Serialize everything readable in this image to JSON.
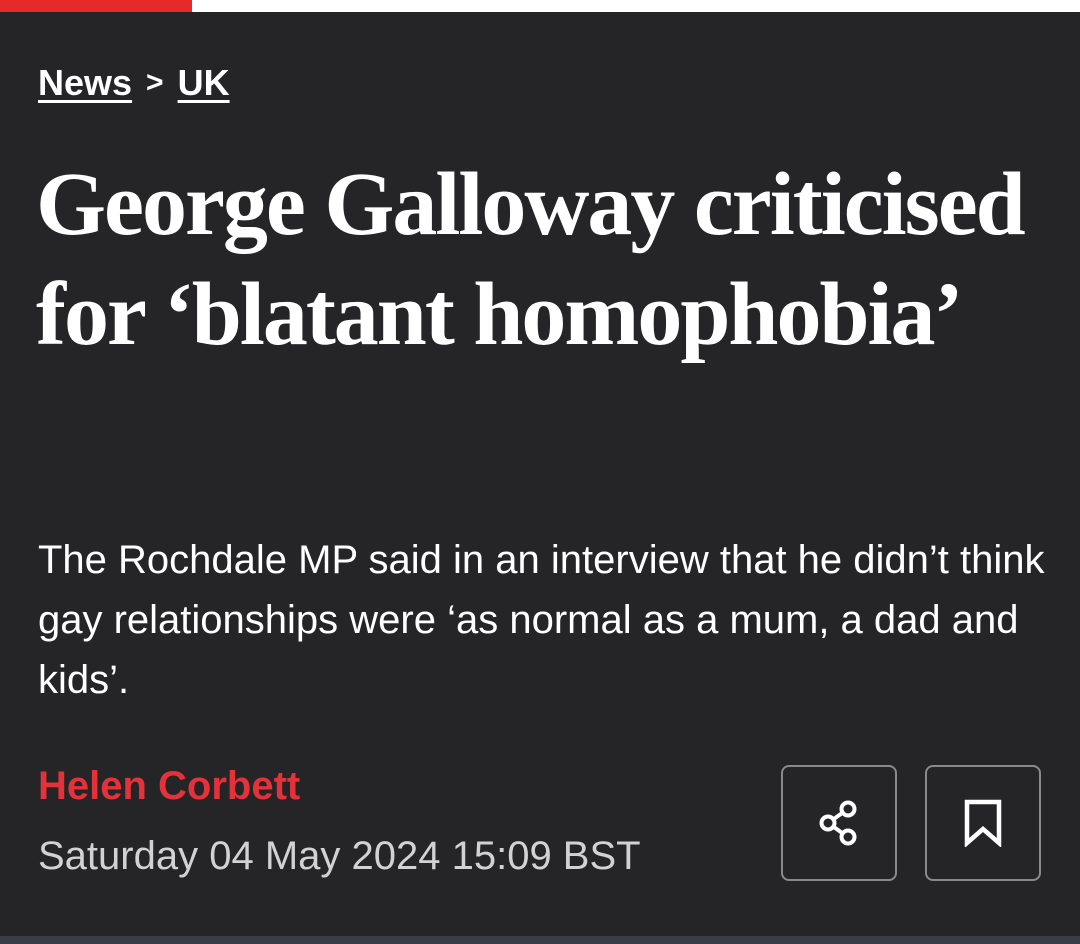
{
  "breadcrumb": {
    "section": "News",
    "separator": ">",
    "subsection": "UK"
  },
  "article": {
    "headline": "George Galloway criticised for ‘blatant homophobia’",
    "standfirst": "The Rochdale MP said in an interview that he didn’t think gay relationships were ‘as normal as a mum, a dad and kids’.",
    "author": "Helen Corbett",
    "date": "Saturday 04 May 2024 15:09 BST"
  },
  "actions": {
    "share_icon": "share-icon",
    "bookmark_icon": "bookmark-icon"
  },
  "colors": {
    "background": "#252527",
    "accent": "#e42a2a",
    "author": "#e4323a",
    "text": "#ffffff",
    "date": "#d2d2d2"
  }
}
